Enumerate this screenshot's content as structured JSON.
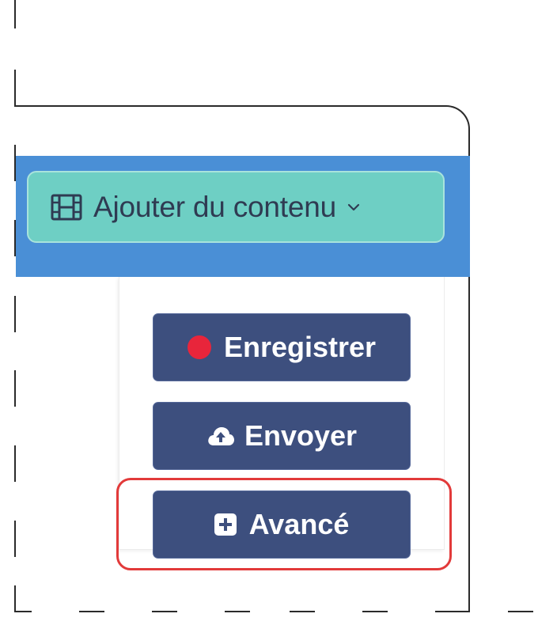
{
  "toolbar": {
    "add_content_label": "Ajouter du contenu",
    "add_content_icon": "film-icon",
    "dropdown_indicator_icon": "chevron-down-icon",
    "header_color": "#4a8fd6",
    "button_color": "#6ecfc4"
  },
  "dropdown": {
    "items": [
      {
        "label": "Enregistrer",
        "icon": "record-dot-icon",
        "icon_color": "#e8253b"
      },
      {
        "label": "Envoyer",
        "icon": "cloud-upload-icon"
      },
      {
        "label": "Avancé",
        "icon": "plus-square-icon",
        "highlighted": true
      }
    ],
    "item_color": "#3d4f7e",
    "highlight_color": "#e23a3a"
  }
}
